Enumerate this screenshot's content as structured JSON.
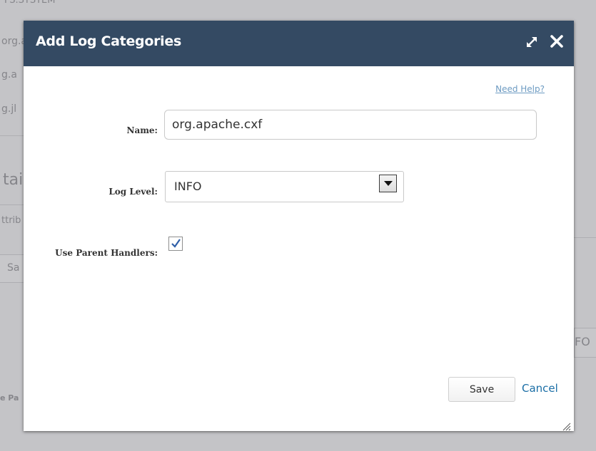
{
  "background": {
    "top_text": "FS.SYSTEM",
    "row1": "org.a",
    "row2": "g.a",
    "row3": "g.jl",
    "section": "tai",
    "attrib": "ttrib",
    "save_fragment": "Sa",
    "right_fragment": "FO",
    "bottom_fragment": "e Pa"
  },
  "dialog": {
    "title": "Add Log Categories",
    "help_link": "Need Help?",
    "name": {
      "label": "Name:",
      "value": "org.apache.cxf"
    },
    "log_level": {
      "label": "Log Level:",
      "value": "INFO"
    },
    "use_parent_handlers": {
      "label": "Use Parent Handlers:",
      "checked": true
    },
    "save_label": "Save",
    "cancel_label": "Cancel"
  },
  "colors": {
    "header": "#344a63",
    "link": "#1a6ea6",
    "help_link": "#6d9bc2"
  },
  "icons": {
    "maximize": "maximize-icon",
    "close": "close-icon",
    "dropdown": "chevron-down-icon",
    "check": "check-icon",
    "resize": "resize-grip-icon"
  }
}
